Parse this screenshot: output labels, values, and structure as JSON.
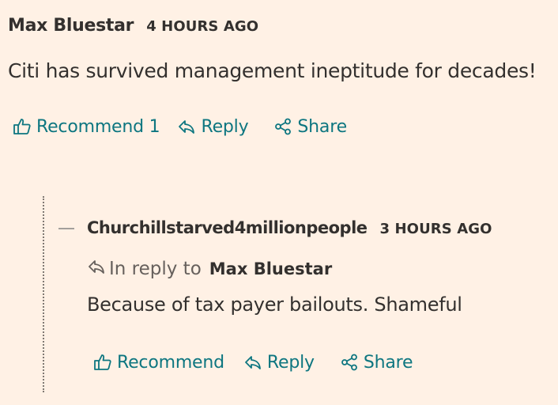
{
  "comments": [
    {
      "author": "Max Bluestar",
      "time": "4 HOURS AGO",
      "text": "Citi has survived management ineptitude for decades!",
      "actions": {
        "recommend": "Recommend 1",
        "reply": "Reply",
        "share": "Share"
      }
    },
    {
      "author": "Churchillstarved4millionpeople",
      "time": "3 HOURS AGO",
      "reply_to_label": "In reply to",
      "reply_to_author": "Max Bluestar",
      "text": "Because of tax payer bailouts. Shameful",
      "actions": {
        "recommend": "Recommend",
        "reply": "Reply",
        "share": "Share"
      }
    }
  ],
  "icons": {
    "recommend": "thumbs-up-icon",
    "reply": "reply-arrow-icon",
    "share": "share-icon"
  },
  "colors": {
    "background": "#fff1e5",
    "action_text": "#0d7680",
    "primary_text": "#33302e",
    "secondary_text": "#66605c"
  }
}
